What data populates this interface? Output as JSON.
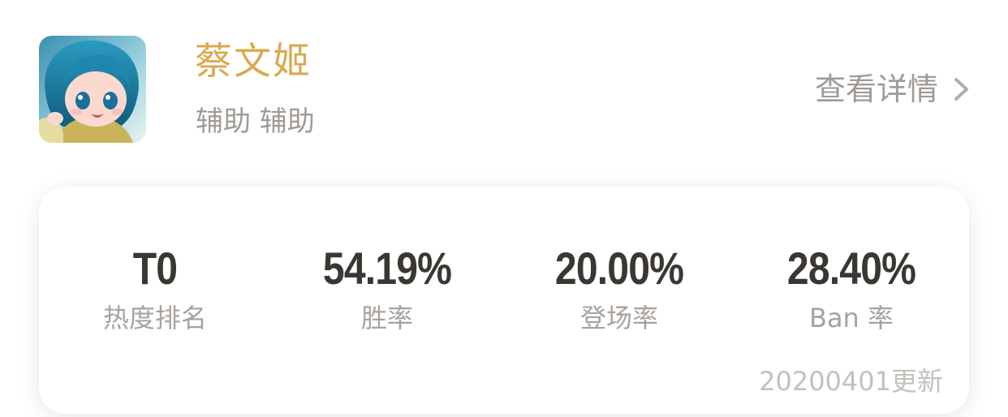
{
  "hero": {
    "name": "蔡文姬",
    "role": "辅助 辅助",
    "detail_label": "查看详情"
  },
  "stats": [
    {
      "value": "T0",
      "label": "热度排名"
    },
    {
      "value": "54.19%",
      "label": "胜率"
    },
    {
      "value": "20.00%",
      "label": "登场率"
    },
    {
      "value": "28.40%",
      "label": "Ban 率"
    }
  ],
  "update_note": "20200401更新",
  "colors": {
    "hero_name": "#d9a94e",
    "secondary_text": "#9f9a95",
    "stat_value": "#3a3632",
    "update_note": "#c4c0bc"
  },
  "icons": {
    "avatar": "hero-portrait",
    "detail": "chevron-right-icon"
  }
}
